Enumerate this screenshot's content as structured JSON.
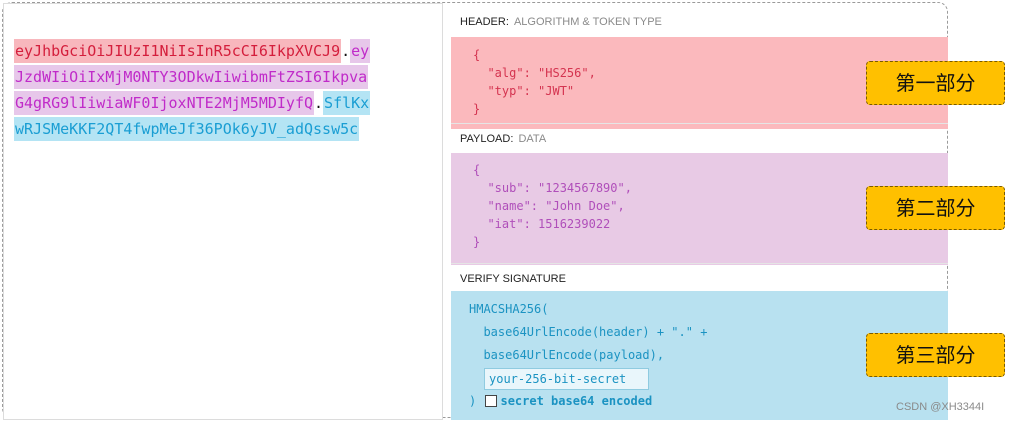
{
  "token": {
    "lines": [
      [
        {
          "text": "eyJhbGciOiJIUzI1NiIsInR5cCI6IkpXVCJ9",
          "color": "red"
        },
        {
          "text": ".",
          "color": "dot"
        },
        {
          "text": "ey",
          "color": "purple"
        }
      ],
      [
        {
          "text": "JzdWIiOiIxMjM0NTY3ODkwIiwibmFtZSI6Ikpva",
          "color": "purple"
        }
      ],
      [
        {
          "text": "G4gRG9lIiwiaWF0IjoxNTE2MjM5MDIyfQ",
          "color": "purple"
        },
        {
          "text": ".",
          "color": "dot"
        },
        {
          "text": "SflKx",
          "color": "blue"
        }
      ],
      [
        {
          "text": "wRJSMeKKF2QT4fwpMeJf36POk6yJV_adQssw5c",
          "color": "blue"
        }
      ]
    ]
  },
  "header_section": {
    "label": "HEADER:",
    "sublabel": "ALGORITHM & TOKEN TYPE",
    "code": [
      "{",
      "  \"alg\": \"HS256\",",
      "  \"typ\": \"JWT\"",
      "}"
    ]
  },
  "payload_section": {
    "label": "PAYLOAD:",
    "sublabel": "DATA",
    "code": [
      "{",
      "  \"sub\": \"1234567890\",",
      "  \"name\": \"John Doe\",",
      "  \"iat\": 1516239022",
      "}"
    ]
  },
  "verify_section": {
    "label": "VERIFY SIGNATURE",
    "lines": [
      "HMACSHA256(",
      "  base64UrlEncode(header) + \".\" +",
      "  base64UrlEncode(payload),"
    ],
    "secret_value": "your-256-bit-secret",
    "close_paren": ")",
    "checkbox_label": "secret base64 encoded",
    "checkbox_checked": false
  },
  "tags": {
    "part1": "第一部分",
    "part2": "第二部分",
    "part3": "第三部分"
  },
  "watermark": "CSDN @XH3344I",
  "colors": {
    "red": "#d41e3c",
    "purple": "#c02bc9",
    "blue": "#1a9ed3",
    "tag_bg": "#ffc000"
  }
}
